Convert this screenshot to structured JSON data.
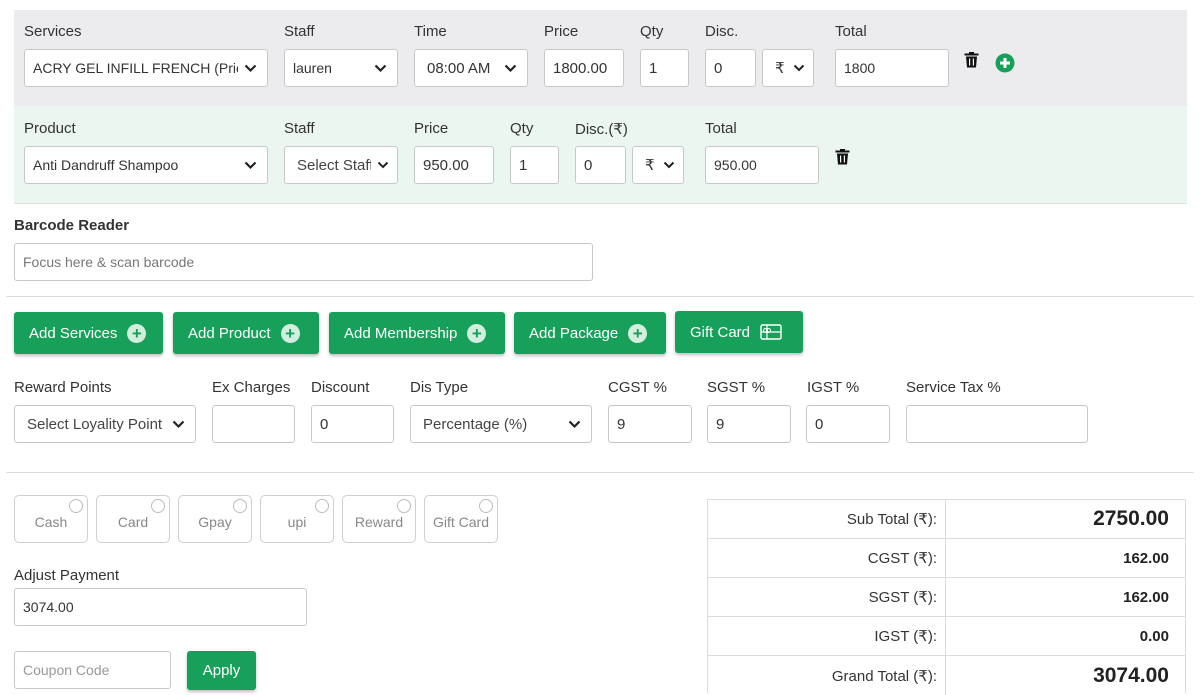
{
  "service_row": {
    "labels": {
      "services": "Services",
      "staff": "Staff",
      "time": "Time",
      "price": "Price",
      "qty": "Qty",
      "disc": "Disc.",
      "total": "Total"
    },
    "service_value": "ACRY GEL INFILL FRENCH (Price:",
    "staff_value": "lauren",
    "time_value": "08:00 AM",
    "price_value": "1800.00",
    "qty_value": "1",
    "disc_value": "0",
    "disc_type_value": "₹",
    "total_value": "1800",
    "icons": [
      "trash-icon",
      "plus-circle-icon"
    ]
  },
  "product_row": {
    "labels": {
      "product": "Product",
      "staff": "Staff",
      "price": "Price",
      "qty": "Qty",
      "disc": "Disc.(₹)",
      "total": "Total"
    },
    "product_value": "Anti Dandruff Shampoo",
    "staff_placeholder": "Select Staff",
    "price_value": "950.00",
    "qty_value": "1",
    "disc_value": "0",
    "disc_type_value": "₹",
    "total_value": "950.00",
    "icons": [
      "trash-icon"
    ]
  },
  "barcode": {
    "label": "Barcode Reader",
    "placeholder": "Focus here & scan barcode"
  },
  "actions": {
    "add_services": "Add Services",
    "add_product": "Add Product",
    "add_membership": "Add Membership",
    "add_package": "Add Package",
    "gift_card": "Gift Card"
  },
  "charges": {
    "labels": {
      "reward_points": "Reward Points",
      "ex_charges": "Ex Charges",
      "discount": "Discount",
      "dis_type": "Dis Type",
      "cgst": "CGST %",
      "sgst": "SGST %",
      "igst": "IGST %",
      "service_tax": "Service Tax %"
    },
    "reward_placeholder": "Select Loyality Point",
    "ex_charges_value": "",
    "discount_value": "0",
    "dis_type_value": "Percentage (%)",
    "cgst_value": "9",
    "sgst_value": "9",
    "igst_value": "0",
    "service_tax_value": ""
  },
  "payment_methods": [
    "Cash",
    "Card",
    "Gpay",
    "upi",
    "Reward",
    "Gift Card"
  ],
  "adjust_payment": {
    "label": "Adjust Payment",
    "value": "3074.00"
  },
  "coupon": {
    "placeholder": "Coupon Code",
    "apply_label": "Apply"
  },
  "summary": [
    {
      "label": "Sub Total (₹):",
      "value": "2750.00"
    },
    {
      "label": "CGST (₹):",
      "value": "162.00"
    },
    {
      "label": "SGST (₹):",
      "value": "162.00"
    },
    {
      "label": "IGST (₹):",
      "value": "0.00"
    },
    {
      "label": "Grand Total (₹):",
      "value": "3074.00"
    }
  ],
  "colors": {
    "accent": "#17a05a",
    "service_row_bg": "#ececef",
    "product_row_bg": "#eaf6ef"
  }
}
